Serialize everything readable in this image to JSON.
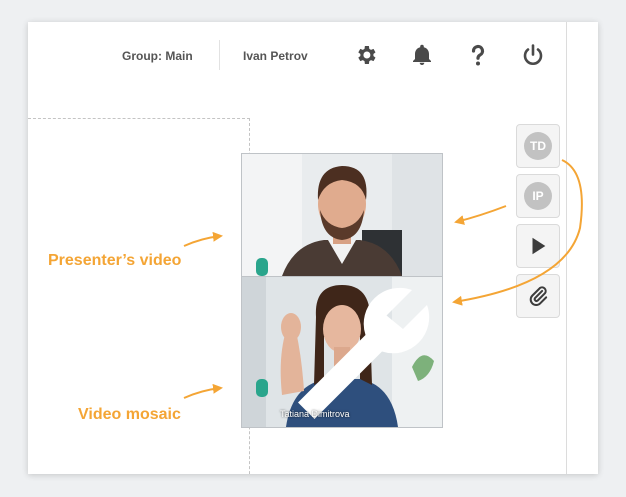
{
  "header": {
    "group_label": "Group: Main",
    "user_name": "Ivan Petrov",
    "icons": [
      "gear-icon",
      "bell-icon",
      "question-icon",
      "power-icon"
    ]
  },
  "videos": {
    "mosaic_participant_name": "Tatiana Dimitrova"
  },
  "side_panel": {
    "avatar_1": "TD",
    "avatar_2": "IP",
    "icons": [
      "play-icon",
      "paperclip-icon"
    ]
  },
  "annotations": {
    "presenter_label": "Presenter’s video",
    "mosaic_label": "Video mosaic"
  },
  "colors": {
    "accent": "#f4a535",
    "icon": "#4a4a4a",
    "avatar_bg": "#c2c2c2"
  }
}
